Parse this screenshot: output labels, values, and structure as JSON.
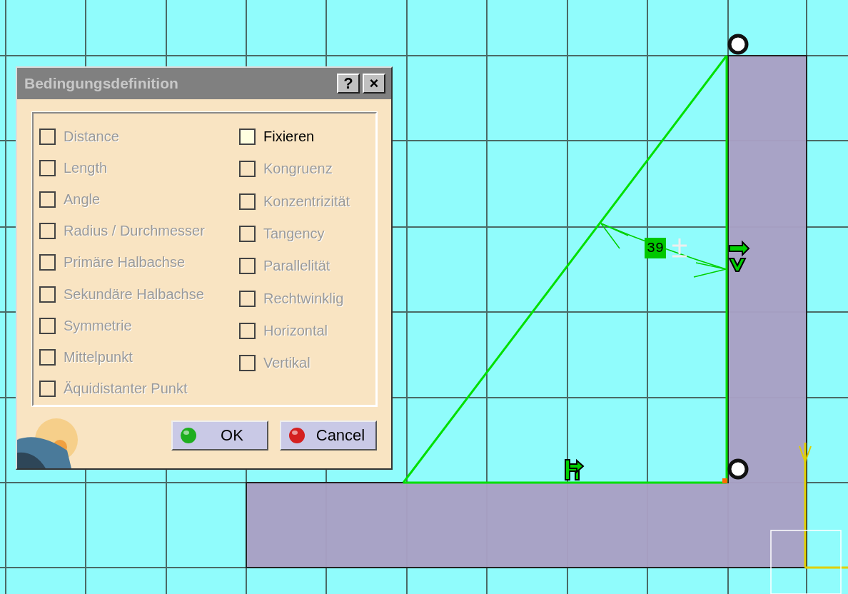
{
  "dialog": {
    "title": "Bedingungsdefinition",
    "title_buttons": [
      "?",
      "×"
    ],
    "columns": [
      [
        {
          "label": "Distance",
          "checked": false,
          "disabled": true
        },
        {
          "label": "Length",
          "checked": false,
          "disabled": true
        },
        {
          "label": "Angle",
          "checked": false,
          "disabled": true
        },
        {
          "label": "Radius / Durchmesser",
          "checked": false,
          "disabled": true
        },
        {
          "label": "Primäre Halbachse",
          "checked": false,
          "disabled": true
        },
        {
          "label": "Sekundäre Halbachse",
          "checked": false,
          "disabled": true
        },
        {
          "label": "Symmetrie",
          "checked": false,
          "disabled": true
        },
        {
          "label": "Mittelpunkt",
          "checked": false,
          "disabled": true
        },
        {
          "label": "Äquidistanter Punkt",
          "checked": false,
          "disabled": true
        }
      ],
      [
        {
          "label": "Fixieren",
          "checked": false,
          "disabled": false
        },
        {
          "label": "Kongruenz",
          "checked": false,
          "disabled": true
        },
        {
          "label": "Konzentrizität",
          "checked": false,
          "disabled": true
        },
        {
          "label": "Tangency",
          "checked": false,
          "disabled": true
        },
        {
          "label": "Parallelität",
          "checked": false,
          "disabled": true
        },
        {
          "label": "Rechtwinklig",
          "checked": false,
          "disabled": true
        },
        {
          "label": "Horizontal",
          "checked": false,
          "disabled": true
        },
        {
          "label": "Vertikal",
          "checked": false,
          "disabled": true
        }
      ]
    ],
    "buttons": [
      {
        "kind": "ok",
        "label": "OK"
      },
      {
        "kind": "cancel",
        "label": "Cancel"
      }
    ]
  },
  "sketch": {
    "angle_dimension": "39"
  }
}
